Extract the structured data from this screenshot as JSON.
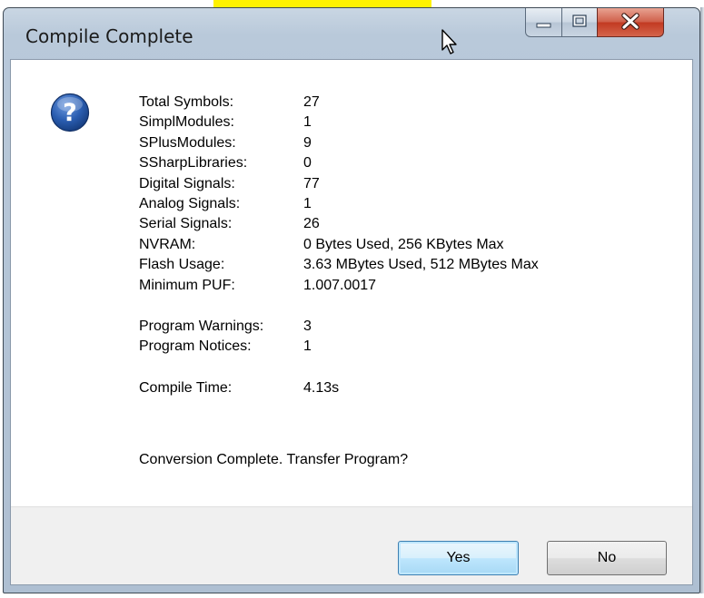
{
  "window": {
    "title": "Compile Complete"
  },
  "summary": {
    "rows": [
      {
        "label": "Total Symbols:",
        "value": "27"
      },
      {
        "label": "SimplModules:",
        "value": "1"
      },
      {
        "label": "SPlusModules:",
        "value": "9"
      },
      {
        "label": "SSharpLibraries:",
        "value": "0"
      },
      {
        "label": "Digital Signals:",
        "value": "77"
      },
      {
        "label": "Analog Signals:",
        "value": "1"
      },
      {
        "label": "Serial Signals:",
        "value": "26"
      },
      {
        "label": "NVRAM:",
        "value": "0 Bytes Used, 256 KBytes Max"
      },
      {
        "label": "Flash Usage:",
        "value": "3.63 MBytes Used, 512 MBytes Max"
      },
      {
        "label": "Minimum PUF:",
        "value": "1.007.0017"
      }
    ],
    "diagnostics": [
      {
        "label": "Program Warnings:",
        "value": "3"
      },
      {
        "label": "Program Notices:",
        "value": "1"
      }
    ],
    "timing": [
      {
        "label": "Compile Time:",
        "value": "4.13s"
      }
    ]
  },
  "message": "Conversion Complete.  Transfer Program?",
  "buttons": {
    "yes": "Yes",
    "no": "No"
  },
  "icons": {
    "dialog": "help-question-icon",
    "cursor": "mouse-pointer-icon"
  },
  "colors": {
    "highlight": "#fff200",
    "close_button": "#c23a22",
    "help_icon": "#2a5db0"
  }
}
